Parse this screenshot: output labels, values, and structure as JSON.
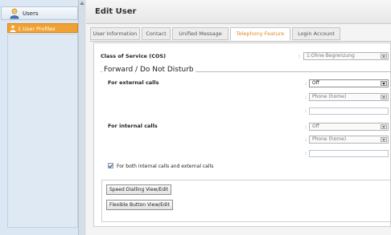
{
  "sidebar": {
    "header_label": "Users",
    "items": [
      {
        "label": "1.User Profiles"
      }
    ]
  },
  "main": {
    "title": "Edit User",
    "tabs": [
      {
        "label": "User Information"
      },
      {
        "label": "Contact"
      },
      {
        "label": "Unified Message"
      },
      {
        "label": "Telephony Feature",
        "active": true
      },
      {
        "label": "Login Account"
      }
    ]
  },
  "form": {
    "cos_label": "Class of Service (COS)",
    "cos_value": "1:Ohne Begrenzung",
    "fieldset_legend": "Forward / Do Not Disturb",
    "external_label": "For external calls",
    "external_mode": "Off",
    "external_dest": "Phone (home)",
    "internal_label": "For internal calls",
    "internal_mode": "Off",
    "internal_dest": "Phone (home)",
    "both_checkbox_label": "For both internal calls and external calls",
    "colon": ":"
  },
  "buttons": {
    "speed_dialling": "Speed Dialling View/Edit",
    "flexible_button": "Flexible Button View/Edit"
  }
}
